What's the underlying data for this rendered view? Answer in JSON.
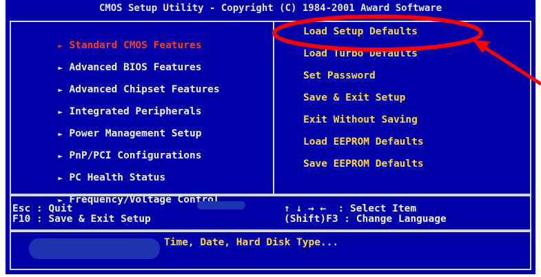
{
  "title": "CMOS Setup Utility - Copyright (C) 1984-2001 Award Software",
  "left_menu": [
    {
      "label": "Standard CMOS Features",
      "selected": true
    },
    {
      "label": "Advanced BIOS Features",
      "selected": false
    },
    {
      "label": "Advanced Chipset Features",
      "selected": false
    },
    {
      "label": "Integrated Peripherals",
      "selected": false
    },
    {
      "label": "Power Management Setup",
      "selected": false
    },
    {
      "label": "PnP/PCI Configurations",
      "selected": false
    },
    {
      "label": "PC Health Status",
      "selected": false
    },
    {
      "label": "Frequency/Voltage Control",
      "selected": false
    }
  ],
  "right_menu": [
    {
      "label": "Load Setup Defaults"
    },
    {
      "label": "Load Turbo Defaults"
    },
    {
      "label": "Set Password"
    },
    {
      "label": "Save & Exit Setup"
    },
    {
      "label": "Exit Without Saving"
    },
    {
      "label": "Load EEPROM Defaults"
    },
    {
      "label": "Save EEPROM Defaults"
    }
  ],
  "arrow_glyph": "►",
  "help": {
    "left_line1": "Esc : Quit",
    "left_line2": "F10 : Save & Exit Setup",
    "right_line1": "↑ ↓ → ←  : Select Item",
    "right_line2": "(Shift)F3 : Change Language"
  },
  "status_text": "Time, Date, Hard Disk Type...",
  "annotation": {
    "shape": "red ellipse with arrow",
    "target": "Load Setup Defaults",
    "color": "#ff0000"
  },
  "colors": {
    "background": "#0000a8",
    "border": "#d8d8d8",
    "text_white": "#f2f2f2",
    "text_yellow": "#ffd84a",
    "text_selected": "#ff3a22"
  }
}
